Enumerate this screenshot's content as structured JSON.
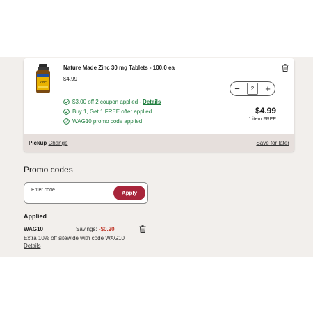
{
  "cart_item": {
    "title": "Nature Made Zinc 30 mg Tablets - 100.0 ea",
    "price": "$4.99",
    "quantity": "2",
    "decrement_symbol": "−",
    "increment_symbol": "+",
    "offers": [
      {
        "text": "$3.00 off 2 coupon applied - ",
        "link": "Details"
      },
      {
        "text": "Buy 1, Get 1 FREE offer applied"
      },
      {
        "text": "WAG10 promo code applied"
      }
    ],
    "total": "$4.99",
    "free_note": "1 item FREE",
    "product_label": "Zinc"
  },
  "fulfillment": {
    "mode_label": "Pickup",
    "change_link": "Change",
    "save_for_later": "Save for later"
  },
  "promo": {
    "heading": "Promo codes",
    "input_placeholder": "Enter code",
    "apply_label": "Apply"
  },
  "applied": {
    "heading": "Applied",
    "code": "WAG10",
    "savings_label": "Savings: ",
    "savings_amount": "-$0.20",
    "description": "Extra 10% off sitewide with code WAG10",
    "details_link": "Details"
  },
  "colors": {
    "accent_red": "#a8253a",
    "offer_green": "#1e7d3d",
    "savings_red": "#c0392b",
    "panel_bg": "#f2efec",
    "footer_bg": "#e6dfdc"
  },
  "icons": {
    "delete": "trash-icon",
    "offer_status": "check-circle-icon",
    "product": "product-bottle-image"
  }
}
